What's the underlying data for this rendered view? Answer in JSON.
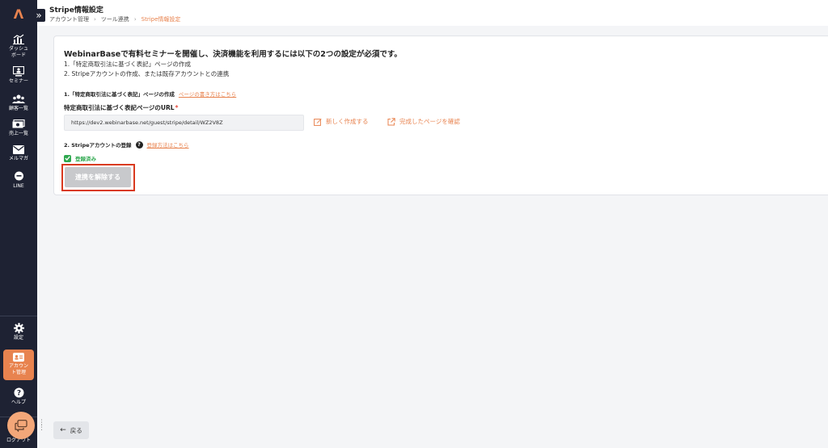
{
  "app": {
    "logo_text": "Λ",
    "collapse_icon": "chevron-double-right"
  },
  "sidebar": {
    "items": [
      {
        "label": "ダッシュ\nボード",
        "icon": "chart-icon"
      },
      {
        "label": "セミナー",
        "icon": "monitor-icon"
      },
      {
        "label": "顧客一覧",
        "icon": "users-icon"
      },
      {
        "label": "売上一覧",
        "icon": "money-icon"
      },
      {
        "label": "メルマガ",
        "icon": "mail-icon"
      },
      {
        "label": "LINE",
        "icon": "line-icon"
      }
    ],
    "bottom_items": [
      {
        "label": "設定",
        "icon": "gear-icon"
      },
      {
        "label": "アカウン\nト管理",
        "icon": "account-icon",
        "active": true
      },
      {
        "label": "ヘルプ",
        "icon": "help-icon"
      },
      {
        "label": "ログアウト",
        "icon": "logout-icon"
      }
    ],
    "active_color": "#e8834f"
  },
  "header": {
    "title": "Stripe情報設定",
    "breadcrumb": [
      "アカウント管理",
      "ツール連携",
      "Stripe情報設定"
    ]
  },
  "main": {
    "headline": "WebinarBaseで有料セミナーを開催し、決済機能を利用するには以下の2つの設定が必須です。",
    "requirements": [
      "1.「特定商取引法に基づく表記」ページの作成",
      "2. Stripeアカウントの作成、または既存アカウントとの連携"
    ],
    "section1": {
      "title": "1.「特定商取引法に基づく表記」ページの作成",
      "help_link": "ページの書き方はこちら",
      "url_label": "特定商取引法に基づく表記ページのURL",
      "required_mark": "*",
      "url_value": "https://dev2.webinarbase.net/guest/stripe/detail/WZ2V8Z",
      "create_label": "新しく作成する",
      "view_label": "完成したページを確認"
    },
    "section2": {
      "title": "2. Stripeアカウントの登録",
      "help_link": "登録方法はこちら",
      "status": "登録済み",
      "disconnect_label": "連携を解除する"
    }
  },
  "footer": {
    "back_label": "戻る"
  },
  "colors": {
    "accent": "#e8834f",
    "success": "#2fa84f",
    "highlight": "#d93a1f"
  }
}
